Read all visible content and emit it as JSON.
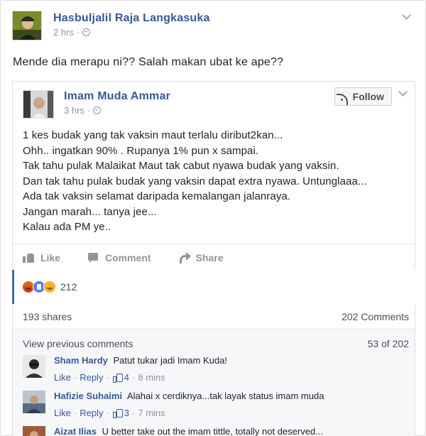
{
  "post": {
    "author": "Hasbuljalil Raja Langkasuka",
    "time": "2 hrs",
    "text": "Mende dia merapu ni?? Salah makan ubat ke ape??"
  },
  "shared_post": {
    "author": "Imam Muda Ammar",
    "time": "3 hrs",
    "follow_label": "Follow",
    "lines": [
      "1 kes budak yang tak vaksin maut terlalu diribut2kan...",
      "Ohh.. ingatkan 90% . Rupanya 1% pun x sampai.",
      "Tak tahu pulak Malaikat Maut tak cabut nyawa budak yang vaksin.",
      "Dan tak tahu pulak budak yang vaksin dapat extra nyawa. Untunglaaa...",
      "Ada tak vaksin selamat daripada kemalangan jalanraya.",
      "Jangan marah... tanya jee...",
      "Kalau ada PM ye.."
    ],
    "actions": {
      "like": "Like",
      "comment": "Comment",
      "share": "Share"
    }
  },
  "reactions": {
    "icons": [
      "angry-reaction-icon",
      "like-reaction-icon",
      "haha-reaction-icon"
    ],
    "count": "212"
  },
  "stats": {
    "shares": "193 shares",
    "comments": "202 Comments"
  },
  "comments_section": {
    "view_previous": "View previous comments",
    "page_count": "53 of 202",
    "items": [
      {
        "author": "Sham Hardy",
        "text": "Patut tukar jadi Imam Kuda!",
        "like_label": "Like",
        "reply_label": "Reply",
        "likes": "4",
        "time": "8 mins"
      },
      {
        "author": "Hafizie Suhaimi",
        "text": "Alahai x cerdiknya...tak layak status imam muda",
        "like_label": "Like",
        "reply_label": "Reply",
        "likes": "3",
        "time": "7 mins"
      },
      {
        "author": "Aizat Ilias",
        "text": "U better take out the imam tittle, totally not deserved..."
      }
    ]
  },
  "colors": {
    "link_blue": "#365899",
    "muted_gray": "#90949c",
    "text": "#1d2129",
    "border": "#dddfe2",
    "comments_bg": "#f6f7f9"
  }
}
